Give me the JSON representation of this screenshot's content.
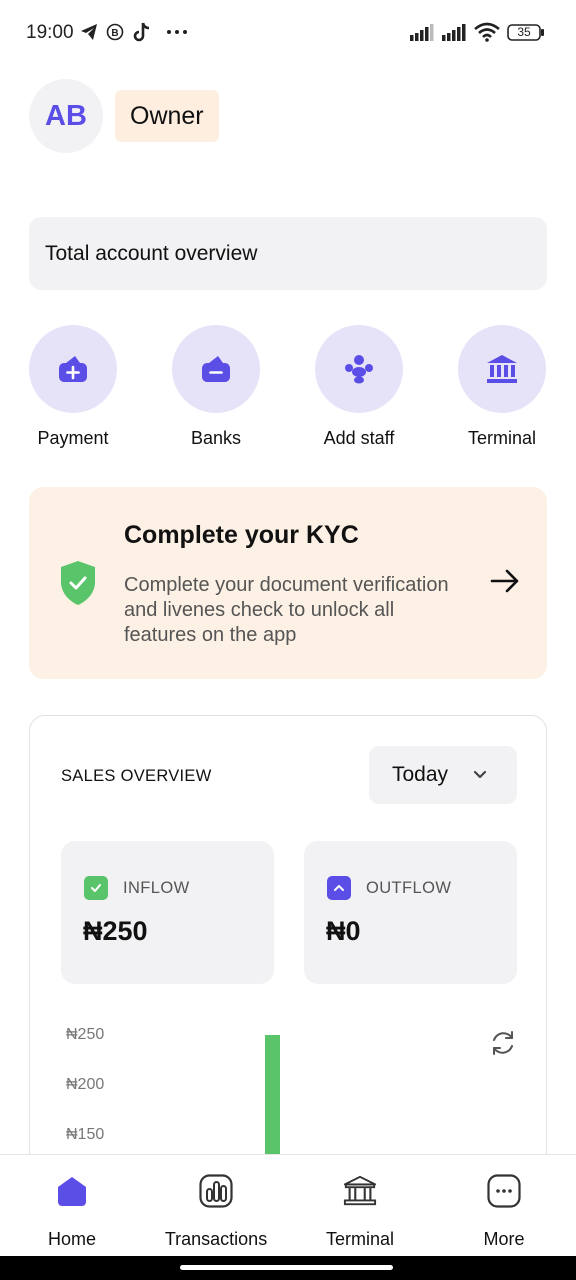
{
  "status_bar": {
    "time": "19:00",
    "battery": "35",
    "icons": [
      "telegram-icon",
      "b-icon",
      "tiktok-icon",
      "more-dots-icon",
      "signal-icon",
      "signal-icon",
      "wifi-icon",
      "battery-icon"
    ]
  },
  "header": {
    "avatar_initials": "AB",
    "role": "Owner"
  },
  "overview": {
    "label": "Total account overview"
  },
  "quick_actions": [
    {
      "label": "Payment",
      "icon": "wallet-add-icon"
    },
    {
      "label": "Banks",
      "icon": "wallet-remove-icon"
    },
    {
      "label": "Add staff",
      "icon": "users-icon"
    },
    {
      "label": "Terminal",
      "icon": "bank-building-icon"
    }
  ],
  "kyc": {
    "title": "Complete your KYC",
    "description": "Complete your document verification and livenes check to unlock all features on the app",
    "icon": "shield-check-icon",
    "arrow_icon": "arrow-right-icon"
  },
  "sales_overview": {
    "title": "SALES OVERVIEW",
    "period": "Today",
    "inflow": {
      "label": "INFLOW",
      "amount": "₦250",
      "color": "#5ac46a"
    },
    "outflow": {
      "label": "OUTFLOW",
      "amount": "₦0",
      "color": "#5b4ee6"
    }
  },
  "chart_data": {
    "type": "bar",
    "title": "",
    "xlabel": "",
    "ylabel": "",
    "ytick_labels": [
      "₦250",
      "₦200",
      "₦150"
    ],
    "ylim": [
      150,
      250
    ],
    "values": [
      250
    ],
    "bar_color": "#5ac46a"
  },
  "bottom_nav": [
    {
      "label": "Home",
      "icon": "home-icon",
      "active": true
    },
    {
      "label": "Transactions",
      "icon": "transactions-icon",
      "active": false
    },
    {
      "label": "Terminal",
      "icon": "bank-building-icon",
      "active": false
    },
    {
      "label": "More",
      "icon": "more-icon",
      "active": false
    }
  ],
  "colors": {
    "accent": "#5b4ee6",
    "accent_light": "#e6e3f8",
    "success": "#5ac46a",
    "kyc_bg": "#fdf1e5",
    "badge_bg": "#fdeedf"
  }
}
